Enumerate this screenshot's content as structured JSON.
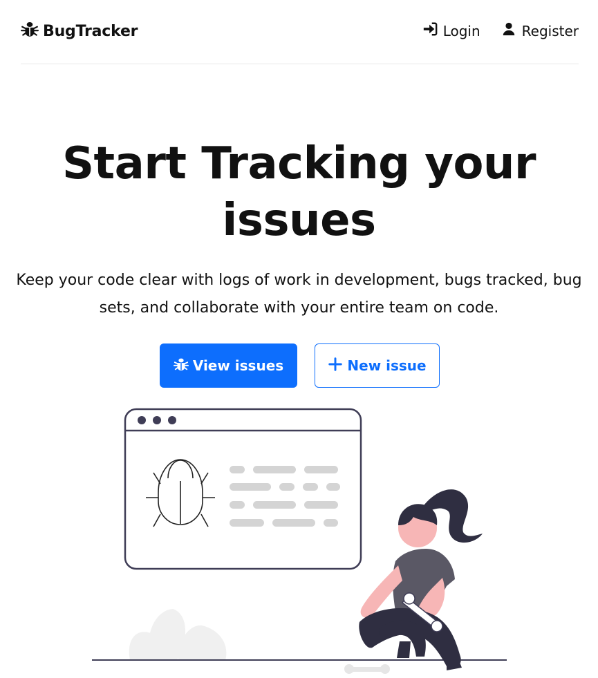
{
  "navbar": {
    "brand": "BugTracker",
    "brand_icon": "bug-icon",
    "links": [
      {
        "label": "Login",
        "icon": "sign-in-icon"
      },
      {
        "label": "Register",
        "icon": "user-icon"
      }
    ]
  },
  "hero": {
    "title": "Start Tracking your issues",
    "subtitle": "Keep your code clear with logs of work in development, bugs tracked, bug sets, and collaborate with your entire team on code.",
    "primary_button": {
      "label": "View issues",
      "icon": "bug-icon"
    },
    "secondary_button": {
      "label": "New issue",
      "icon": "plus-icon"
    }
  },
  "colors": {
    "primary": "#0d6efd",
    "text": "#111111",
    "illustration_dark": "#3f3d56",
    "illustration_accent": "#f4a8a8"
  }
}
